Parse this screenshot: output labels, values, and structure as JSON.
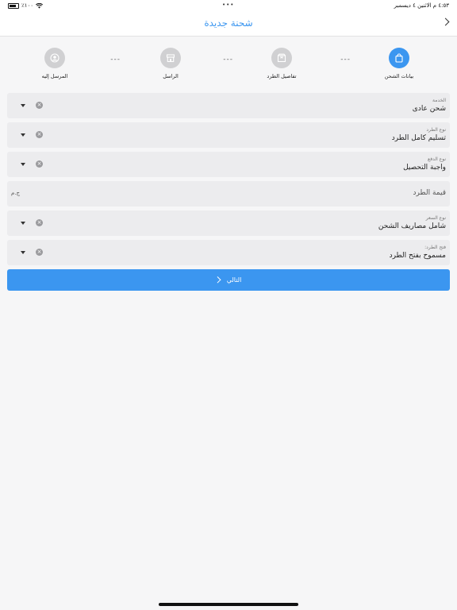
{
  "status_bar": {
    "time_date": "٤:٥٣ م   الاثنين ٤ ديسمبر",
    "battery": "٪١٠٠",
    "dots": "•••"
  },
  "header": {
    "title": "شحنة جديدة"
  },
  "stepper": {
    "steps": [
      {
        "label": "بيانات الشحن",
        "icon": "bag-icon",
        "active": true
      },
      {
        "label": "تفاصيل الطرد",
        "icon": "box-icon",
        "active": false
      },
      {
        "label": "الراسل",
        "icon": "store-icon",
        "active": false
      },
      {
        "label": "المرسل إليه",
        "icon": "person-icon",
        "active": false
      }
    ],
    "separator": "---"
  },
  "form": {
    "service": {
      "label": "الخدمة",
      "value": "شحن عادى"
    },
    "package_type": {
      "label": "نوع الطرد",
      "value": "تسليم كامل الطرد"
    },
    "payment_type": {
      "label": "نوع الدفع",
      "value": "واجبة التحصيل"
    },
    "package_value": {
      "placeholder": "قيمة الطرد",
      "suffix": "ج.م"
    },
    "price_type": {
      "label": "نوع السعر",
      "value": "شامل مصاريف الشحن"
    },
    "open_package": {
      "label": "فتح الطرد:",
      "value": "مسموح بفتح الطرد"
    }
  },
  "next_button": {
    "label": "التالي"
  },
  "colors": {
    "accent": "#3b96f0",
    "field_bg": "#ececee",
    "inactive_step": "#d0d0d2"
  }
}
